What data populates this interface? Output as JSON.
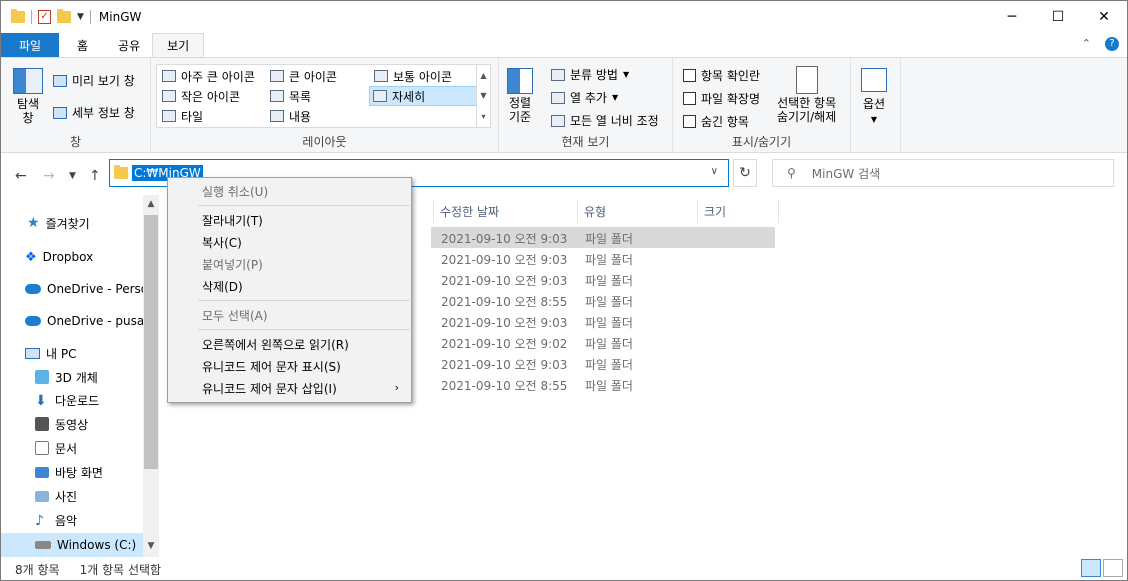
{
  "window": {
    "title": "MinGW",
    "controls": {
      "minimize": "─",
      "maximize": "☐",
      "close": "✕"
    }
  },
  "tabs": [
    {
      "label": "파일"
    },
    {
      "label": "홈"
    },
    {
      "label": "공유"
    },
    {
      "label": "보기"
    }
  ],
  "ribbon": {
    "pane_group": {
      "navigation_pane": "탐색\n창",
      "preview_pane": "미리 보기 창",
      "details_pane": "세부 정보 창",
      "label": "창"
    },
    "layout_group": {
      "items": [
        "아주 큰 아이콘",
        "큰 아이콘",
        "보통 아이콘",
        "작은 아이콘",
        "목록",
        "자세히",
        "타일",
        "내용"
      ],
      "selected": "자세히",
      "label": "레이아웃"
    },
    "current_view_group": {
      "sort_by": "정렬\n기준",
      "group_by": "분류 방법",
      "add_columns": "열 추가",
      "size_all_columns": "모든 열 너비 조정",
      "label": "현재 보기"
    },
    "show_hide_group": {
      "item_check_boxes": "항목 확인란",
      "file_extensions": "파일 확장명",
      "hidden_items": "숨긴 항목",
      "hide_selected": "선택한 항목\n숨기기/해제",
      "label": "표시/숨기기"
    },
    "options": "옵션"
  },
  "address": {
    "path": "C:₩MinGW",
    "search_placeholder": "MinGW 검색"
  },
  "nav_pane": [
    {
      "label": "즐겨찾기",
      "icon": "star-icon"
    },
    {
      "label": "Dropbox",
      "icon": "dropbox-icon"
    },
    {
      "label": "OneDrive - Person",
      "icon": "onedrive-icon"
    },
    {
      "label": "OneDrive - pusan",
      "icon": "onedrive-icon"
    },
    {
      "label": "내 PC",
      "icon": "pc-icon"
    },
    {
      "label": "3D 개체",
      "icon": "3d-objects-icon"
    },
    {
      "label": "다운로드",
      "icon": "downloads-icon"
    },
    {
      "label": "동영상",
      "icon": "videos-icon"
    },
    {
      "label": "문서",
      "icon": "documents-icon"
    },
    {
      "label": "바탕 화면",
      "icon": "desktop-icon"
    },
    {
      "label": "사진",
      "icon": "pictures-icon"
    },
    {
      "label": "음악",
      "icon": "music-icon"
    },
    {
      "label": "Windows (C:)",
      "icon": "drive-icon"
    }
  ],
  "columns": [
    "수정한 날짜",
    "유형",
    "크기"
  ],
  "rows": [
    {
      "date": "2021-09-10 오전 9:03",
      "type": "파일 폴더"
    },
    {
      "date": "2021-09-10 오전 9:03",
      "type": "파일 폴더"
    },
    {
      "date": "2021-09-10 오전 9:03",
      "type": "파일 폴더"
    },
    {
      "date": "2021-09-10 오전 8:55",
      "type": "파일 폴더"
    },
    {
      "date": "2021-09-10 오전 9:03",
      "type": "파일 폴더"
    },
    {
      "date": "2021-09-10 오전 9:02",
      "type": "파일 폴더"
    },
    {
      "date": "2021-09-10 오전 9:03",
      "type": "파일 폴더"
    },
    {
      "date": "2021-09-10 오전 8:55",
      "type": "파일 폴더"
    }
  ],
  "context_menu": {
    "undo": "실행 취소(U)",
    "cut": "잘라내기(T)",
    "copy": "복사(C)",
    "paste": "붙여넣기(P)",
    "delete": "삭제(D)",
    "select_all": "모두 선택(A)",
    "rtl": "오른쪽에서 왼쪽으로 읽기(R)",
    "show_unicode": "유니코드 제어 문자 표시(S)",
    "insert_unicode": "유니코드 제어 문자 삽입(I)"
  },
  "status": {
    "item_count": "8개 항목",
    "selected": "1개 항목 선택함"
  }
}
